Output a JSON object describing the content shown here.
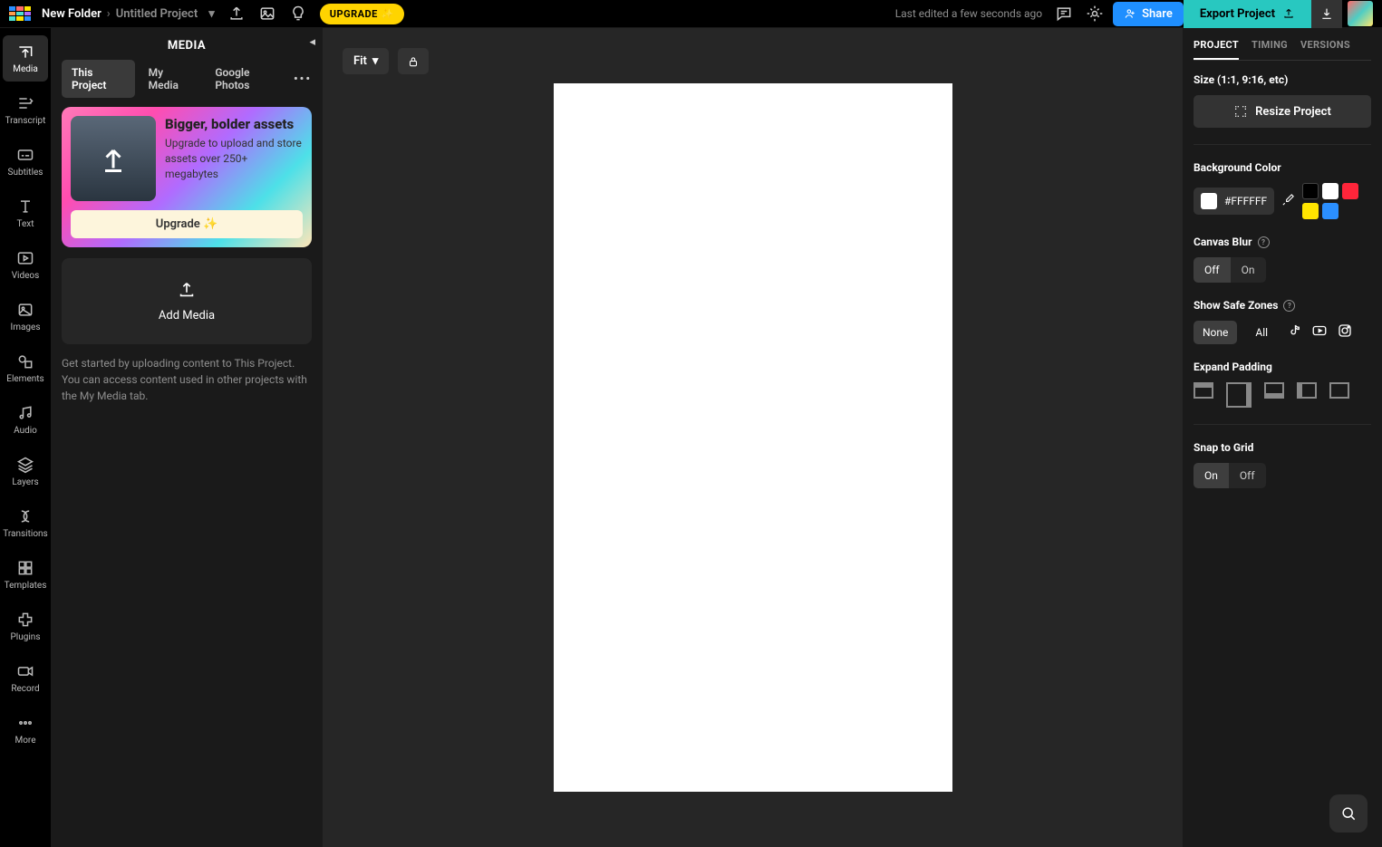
{
  "header": {
    "folder": "New Folder",
    "project": "Untitled Project",
    "upgrade_pill": "UPGRADE",
    "last_edited": "Last edited a few seconds ago",
    "share": "Share",
    "export": "Export Project"
  },
  "rail": [
    {
      "label": "Media"
    },
    {
      "label": "Transcript"
    },
    {
      "label": "Subtitles"
    },
    {
      "label": "Text"
    },
    {
      "label": "Videos"
    },
    {
      "label": "Images"
    },
    {
      "label": "Elements"
    },
    {
      "label": "Audio"
    },
    {
      "label": "Layers"
    },
    {
      "label": "Transitions"
    },
    {
      "label": "Templates"
    },
    {
      "label": "Plugins"
    },
    {
      "label": "Record"
    },
    {
      "label": "More"
    }
  ],
  "side": {
    "title": "MEDIA",
    "tabs": [
      "This Project",
      "My Media",
      "Google Photos"
    ],
    "promo": {
      "title": "Bigger, bolder assets",
      "body": "Upgrade to upload and store assets over 250+ megabytes",
      "cta": "Upgrade"
    },
    "add_media": "Add Media",
    "hint": "Get started by uploading content to This Project. You can access content used in other projects with the My Media tab."
  },
  "canvas": {
    "fit": "Fit"
  },
  "right": {
    "tabs": [
      "PROJECT",
      "TIMING",
      "VERSIONS"
    ],
    "size_label": "Size (1:1, 9:16, etc)",
    "resize": "Resize Project",
    "bg_label": "Background Color",
    "bg_hex": "#FFFFFF",
    "blur_label": "Canvas Blur",
    "blur_options": [
      "Off",
      "On"
    ],
    "safe_label": "Show Safe Zones",
    "safe_options": [
      "None",
      "All"
    ],
    "padding_label": "Expand Padding",
    "snap_label": "Snap to Grid",
    "snap_options": [
      "On",
      "Off"
    ]
  }
}
